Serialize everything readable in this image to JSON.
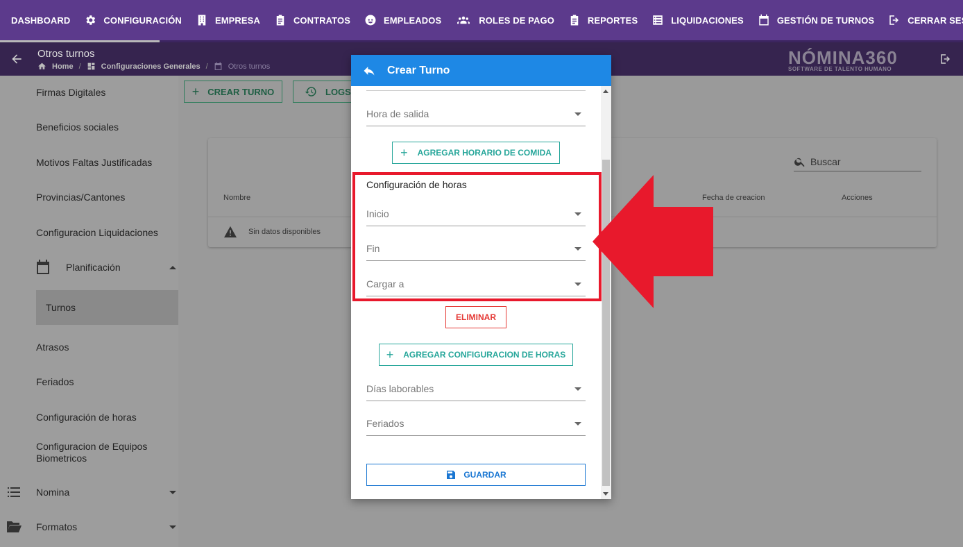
{
  "topnav": {
    "items": [
      {
        "label": "DASHBOARD",
        "icon": "none"
      },
      {
        "label": "CONFIGURACIÓN",
        "icon": "gear-icon"
      },
      {
        "label": "EMPRESA",
        "icon": "building-icon"
      },
      {
        "label": "CONTRATOS",
        "icon": "clipboard-icon"
      },
      {
        "label": "EMPLEADOS",
        "icon": "face-icon"
      },
      {
        "label": "ROLES DE PAGO",
        "icon": "group-icon"
      },
      {
        "label": "REPORTES",
        "icon": "clipboard-icon"
      },
      {
        "label": "LIQUIDACIONES",
        "icon": "list-icon"
      },
      {
        "label": "GESTIÓN DE TURNOS",
        "icon": "calendar-icon"
      },
      {
        "label": "CERRAR SESIÓN",
        "icon": "logout-icon"
      }
    ]
  },
  "header": {
    "title": "Otros turnos",
    "breadcrumb": [
      "Home",
      "Configuraciones Generales",
      "Otros turnos"
    ],
    "logo_main": "NÓMINA360",
    "logo_sub": "SOFTWARE DE TALENTO HUMANO"
  },
  "sidebar": {
    "items": [
      {
        "label": "Firmas Digitales"
      },
      {
        "label": "Beneficios sociales"
      },
      {
        "label": "Motivos Faltas Justificadas"
      },
      {
        "label": "Provincias/Cantones"
      },
      {
        "label": "Configuracion Liquidaciones"
      },
      {
        "label": "Planificación"
      },
      {
        "label": "Turnos"
      },
      {
        "label": "Atrasos"
      },
      {
        "label": "Feriados"
      },
      {
        "label": "Configuración de horas"
      },
      {
        "label": "Configuracion de Equipos Biometricos"
      },
      {
        "label": "Nomina"
      },
      {
        "label": "Formatos"
      }
    ]
  },
  "main": {
    "create_label": "CREAR TURNO",
    "logs_label": "LOGS",
    "search_placeholder": "Buscar",
    "columns": [
      "Nombre",
      "Fecha de creacion",
      "Acciones"
    ],
    "empty_text": "Sin datos disponibles"
  },
  "modal": {
    "title": "Crear Turno",
    "hora_salida": "Hora de salida",
    "add_meal_label": "AGREGAR HORARIO DE COMIDA",
    "section_title": "Configuración de horas",
    "inicio": "Inicio",
    "fin": "Fin",
    "cargar_a": "Cargar a",
    "delete_label": "ELIMINAR",
    "add_config_label": "AGREGAR CONFIGURACION DE HORAS",
    "dias_laborables": "Días laborables",
    "feriados": "Feriados",
    "save_label": "GUARDAR"
  },
  "colors": {
    "nav": "#5c3a8c",
    "modal_header": "#1e88e5",
    "teal": "#26a69a",
    "danger": "#e53935",
    "annotation": "#e8192c"
  }
}
